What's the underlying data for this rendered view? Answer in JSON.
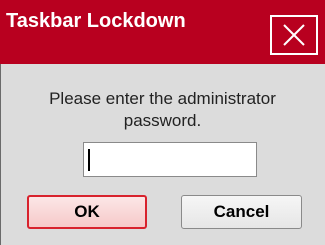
{
  "window": {
    "title": "Taskbar Lockdown",
    "close_icon": "close-icon"
  },
  "dialog": {
    "prompt_line1": "Please enter the administrator",
    "prompt_line2": "password.",
    "password_value": "",
    "ok_label": "OK",
    "cancel_label": "Cancel"
  },
  "colors": {
    "titlebar": "#b8001f",
    "ok_border": "#d8222d",
    "body": "#dcdcdc"
  }
}
